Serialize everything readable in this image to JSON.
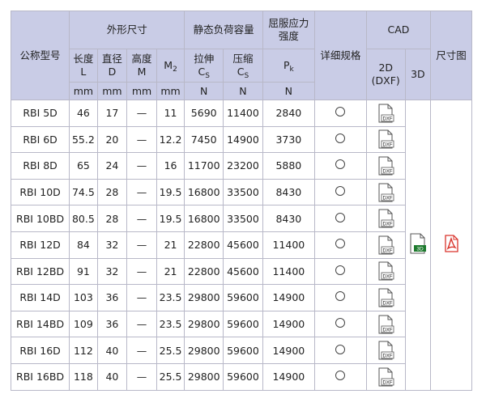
{
  "headers": {
    "model": "公称型号",
    "outer": "外形尺寸",
    "static_load": "静态负荷容量",
    "yield": "屈服应力强度",
    "spec": "详细规格",
    "cad": "CAD",
    "drawing": "尺寸图",
    "length": "长度",
    "length_sym": "L",
    "diameter": "直径",
    "diameter_sym": "D",
    "height": "高度",
    "height_sym": "M",
    "m2": "M",
    "m2_sub": "2",
    "tension": "拉伸",
    "tension_sym": "C",
    "tension_sub": "S",
    "compress": "压缩",
    "compress_sym": "C",
    "compress_sub": "S",
    "pk": "P",
    "pk_sub": "k",
    "dxf_2d": "2D",
    "dxf_label": "(DXF)",
    "three_d": "3D"
  },
  "units": [
    "mm",
    "mm",
    "mm",
    "mm",
    "N",
    "N",
    "N"
  ],
  "rows": [
    {
      "model": "RBI 5D",
      "L": "46",
      "D": "17",
      "M": "—",
      "M2": "11",
      "cs_t": "5690",
      "cs_c": "11400",
      "pk": "2840"
    },
    {
      "model": "RBI 6D",
      "L": "55.2",
      "D": "20",
      "M": "—",
      "M2": "12.2",
      "cs_t": "7450",
      "cs_c": "14900",
      "pk": "3730"
    },
    {
      "model": "RBI 8D",
      "L": "65",
      "D": "24",
      "M": "—",
      "M2": "16",
      "cs_t": "11700",
      "cs_c": "23200",
      "pk": "5880"
    },
    {
      "model": "RBI 10D",
      "L": "74.5",
      "D": "28",
      "M": "—",
      "M2": "19.5",
      "cs_t": "16800",
      "cs_c": "33500",
      "pk": "8430"
    },
    {
      "model": "RBI 10BD",
      "L": "80.5",
      "D": "28",
      "M": "—",
      "M2": "19.5",
      "cs_t": "16800",
      "cs_c": "33500",
      "pk": "8430"
    },
    {
      "model": "RBI 12D",
      "L": "84",
      "D": "32",
      "M": "—",
      "M2": "21",
      "cs_t": "22800",
      "cs_c": "45600",
      "pk": "11400"
    },
    {
      "model": "RBI 12BD",
      "L": "91",
      "D": "32",
      "M": "—",
      "M2": "21",
      "cs_t": "22800",
      "cs_c": "45600",
      "pk": "11400"
    },
    {
      "model": "RBI 14D",
      "L": "103",
      "D": "36",
      "M": "—",
      "M2": "23.5",
      "cs_t": "29800",
      "cs_c": "59600",
      "pk": "14900"
    },
    {
      "model": "RBI 14BD",
      "L": "109",
      "D": "36",
      "M": "—",
      "M2": "23.5",
      "cs_t": "29800",
      "cs_c": "59600",
      "pk": "14900"
    },
    {
      "model": "RBI 16D",
      "L": "112",
      "D": "40",
      "M": "—",
      "M2": "25.5",
      "cs_t": "29800",
      "cs_c": "59600",
      "pk": "14900"
    },
    {
      "model": "RBI 16BD",
      "L": "118",
      "D": "40",
      "M": "—",
      "M2": "25.5",
      "cs_t": "29800",
      "cs_c": "59600",
      "pk": "14900"
    }
  ],
  "icons": {
    "spec": "circle-icon",
    "dxf": "dxf-file-icon",
    "three_d": "3d-file-icon",
    "drawing": "pdf-icon",
    "dxf_text": "DXF",
    "three_d_text": "3D"
  },
  "colors": {
    "header_bg": "#c9cce6",
    "border": "#b8b8c8",
    "pdf_red": "#d9332b",
    "three_d_green": "#1e7a2e"
  }
}
